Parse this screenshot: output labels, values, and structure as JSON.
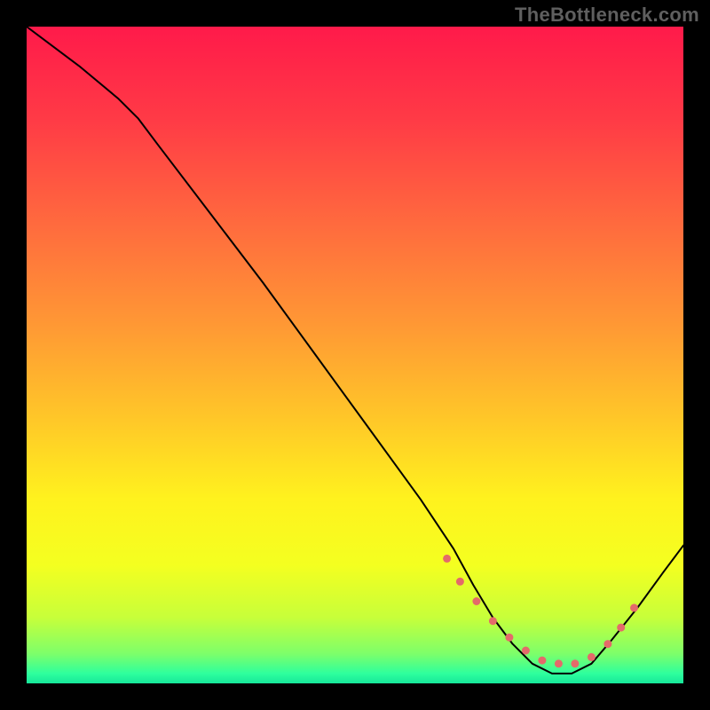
{
  "watermark": "TheBottleneck.com",
  "chart_data": {
    "type": "line",
    "title": "",
    "xlabel": "",
    "ylabel": "",
    "xlim": [
      0,
      100
    ],
    "ylim": [
      0,
      100
    ],
    "grid": false,
    "legend": false,
    "background_gradient_stops": [
      {
        "offset": 0.0,
        "color": "#ff1a4a"
      },
      {
        "offset": 0.14,
        "color": "#ff3a46"
      },
      {
        "offset": 0.3,
        "color": "#ff6a3e"
      },
      {
        "offset": 0.46,
        "color": "#ff9a34"
      },
      {
        "offset": 0.6,
        "color": "#ffc828"
      },
      {
        "offset": 0.72,
        "color": "#fff21e"
      },
      {
        "offset": 0.82,
        "color": "#f4ff20"
      },
      {
        "offset": 0.9,
        "color": "#c7ff3a"
      },
      {
        "offset": 0.955,
        "color": "#7dff6a"
      },
      {
        "offset": 0.985,
        "color": "#2eff9d"
      },
      {
        "offset": 1.0,
        "color": "#16e79a"
      }
    ],
    "series": [
      {
        "name": "bottleneck-curve",
        "color": "#000000",
        "stroke_width": 2,
        "x": [
          0.0,
          8.0,
          14.0,
          17.0,
          20.0,
          28.0,
          36.0,
          44.0,
          52.0,
          60.0,
          65.0,
          68.0,
          71.0,
          74.0,
          77.0,
          80.0,
          83.0,
          86.0,
          89.0,
          93.0,
          97.0,
          100.0
        ],
        "y": [
          100.0,
          94.0,
          89.0,
          86.0,
          82.0,
          71.5,
          61.0,
          50.0,
          39.0,
          28.0,
          20.5,
          15.0,
          10.0,
          6.0,
          3.0,
          1.5,
          1.5,
          3.0,
          6.5,
          11.5,
          17.0,
          21.0
        ]
      }
    ],
    "datapoints_overlay": {
      "name": "highlight-dots",
      "color": "#e46a6a",
      "radius": 4.5,
      "x": [
        64.0,
        66.0,
        68.5,
        71.0,
        73.5,
        76.0,
        78.5,
        81.0,
        83.5,
        86.0,
        88.5,
        90.5,
        92.5
      ],
      "y": [
        19.0,
        15.5,
        12.5,
        9.5,
        7.0,
        5.0,
        3.5,
        3.0,
        3.0,
        4.0,
        6.0,
        8.5,
        11.5
      ]
    }
  }
}
